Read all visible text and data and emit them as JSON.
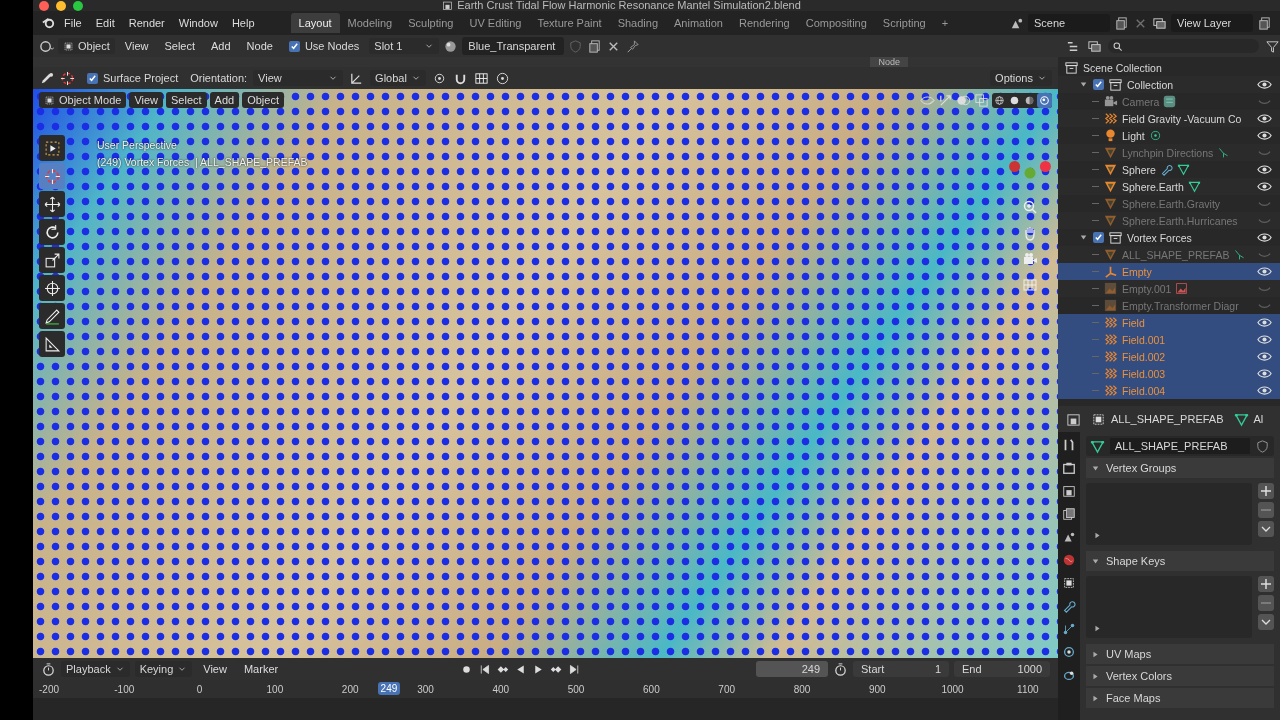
{
  "title_bar": {
    "title": "Earth Crust Tidal Flow Harmonic Resonance Mantel Simulation2.blend"
  },
  "menu_bar": {
    "menus": [
      "File",
      "Edit",
      "Render",
      "Window",
      "Help"
    ],
    "workspaces": [
      {
        "label": "Layout",
        "selected": true
      },
      {
        "label": "Modeling",
        "selected": false
      },
      {
        "label": "Sculpting",
        "selected": false
      },
      {
        "label": "UV Editing",
        "selected": false
      },
      {
        "label": "Texture Paint",
        "selected": false
      },
      {
        "label": "Shading",
        "selected": false
      },
      {
        "label": "Animation",
        "selected": false
      },
      {
        "label": "Rendering",
        "selected": false
      },
      {
        "label": "Compositing",
        "selected": false
      },
      {
        "label": "Scripting",
        "selected": false
      }
    ],
    "add_workspace": "+",
    "scene": "Scene",
    "view_layer": "View Layer"
  },
  "node_header": {
    "editor": "Object",
    "menus": [
      "View",
      "Select",
      "Add",
      "Node"
    ],
    "use_nodes": {
      "label": "Use Nodes",
      "checked": true
    },
    "slot": "Slot 1",
    "material": "Blue_Transparent"
  },
  "tool_settings": {
    "surface_project": {
      "label": "Surface Project",
      "checked": true
    },
    "orientation_label": "Orientation:",
    "orientation": "View",
    "transform": "Global",
    "options": "Options",
    "panel_tab": "Node"
  },
  "viewport": {
    "mode": "Object Mode",
    "menus": [
      "View",
      "Select",
      "Add",
      "Object"
    ],
    "perspective": "User Perspective",
    "info": "(249) Vortex Forces  | ALL_SHAPE_PREFAB",
    "tools": [
      {
        "kind": "select-box",
        "selected": false
      },
      {
        "kind": "cursor",
        "selected": true
      },
      {
        "kind": "move",
        "selected": false
      },
      {
        "kind": "rotate",
        "selected": false
      },
      {
        "kind": "scale",
        "selected": false
      },
      {
        "kind": "transform",
        "selected": false
      },
      {
        "kind": "annotate",
        "selected": false
      },
      {
        "kind": "measure",
        "selected": false
      }
    ],
    "shading": [
      {
        "kind": "wireframe",
        "selected": false
      },
      {
        "kind": "solid",
        "selected": false
      },
      {
        "kind": "material",
        "selected": false
      },
      {
        "kind": "rendered",
        "selected": true
      }
    ]
  },
  "outliner": {
    "root": "Scene Collection",
    "children": [
      {
        "name": "Collection",
        "kind": "collection",
        "checked": true,
        "expanded": true,
        "visible": true,
        "selected": false,
        "children": [
          {
            "name": "Camera",
            "kind": "camera",
            "visible": false,
            "selected": false,
            "extras": [
              {
                "kind": "camera-data"
              }
            ]
          },
          {
            "name": "Field Gravity -Vacuum Co",
            "kind": "field",
            "visible": true,
            "selected": false
          },
          {
            "name": "Light",
            "kind": "light",
            "visible": true,
            "selected": false,
            "extras": [
              {
                "kind": "light-data"
              }
            ]
          },
          {
            "name": "Lynchpin Directions",
            "kind": "mesh",
            "visible": false,
            "selected": false,
            "extras": [
              {
                "kind": "vertex-data"
              }
            ]
          },
          {
            "name": "Sphere",
            "kind": "mesh",
            "visible": true,
            "selected": false,
            "extras": [
              {
                "kind": "modifier"
              },
              {
                "kind": "mesh-data"
              }
            ]
          },
          {
            "name": "Sphere.Earth",
            "kind": "mesh",
            "visible": true,
            "selected": false,
            "extras": [
              {
                "kind": "mesh-data"
              }
            ]
          },
          {
            "name": "Sphere.Earth.Gravity",
            "kind": "mesh",
            "visible": false,
            "selected": false
          },
          {
            "name": "Sphere.Earth.Hurricanes",
            "kind": "mesh",
            "visible": false,
            "selected": false
          }
        ]
      },
      {
        "name": "Vortex Forces",
        "kind": "collection",
        "checked": true,
        "expanded": true,
        "visible": true,
        "selected": false,
        "children": [
          {
            "name": "ALL_SHAPE_PREFAB",
            "kind": "mesh",
            "visible": false,
            "selected": false,
            "extras": [
              {
                "kind": "vertex-data"
              }
            ]
          },
          {
            "name": "Empty",
            "kind": "empty",
            "visible": true,
            "selected": true
          },
          {
            "name": "Empty.001",
            "kind": "image",
            "visible": false,
            "selected": false,
            "extras": [
              {
                "kind": "image-data"
              }
            ]
          },
          {
            "name": "Empty.Transformer Diagr",
            "kind": "image",
            "visible": false,
            "selected": false
          },
          {
            "name": "Field",
            "kind": "field",
            "visible": true,
            "selected": true
          },
          {
            "name": "Field.001",
            "kind": "field",
            "visible": true,
            "selected": true
          },
          {
            "name": "Field.002",
            "kind": "field",
            "visible": true,
            "selected": true
          },
          {
            "name": "Field.003",
            "kind": "field",
            "visible": true,
            "selected": true
          },
          {
            "name": "Field.004",
            "kind": "field",
            "visible": true,
            "selected": true
          }
        ]
      }
    ]
  },
  "properties": {
    "object": "ALL_SHAPE_PREFAB",
    "data_tab": "Al",
    "mesh": "ALL_SHAPE_PREFAB",
    "tabs": [
      {
        "kind": "tool"
      },
      {
        "kind": "render"
      },
      {
        "kind": "output"
      },
      {
        "kind": "view-layer"
      },
      {
        "kind": "scene"
      },
      {
        "kind": "world"
      },
      {
        "kind": "object"
      },
      {
        "kind": "modifier"
      },
      {
        "kind": "particles"
      },
      {
        "kind": "physics"
      },
      {
        "kind": "constraint"
      }
    ],
    "panels": [
      {
        "title": "Vertex Groups",
        "expanded": true
      },
      {
        "title": "Shape Keys",
        "expanded": true
      },
      {
        "title": "UV Maps",
        "expanded": false
      },
      {
        "title": "Vertex Colors",
        "expanded": false
      },
      {
        "title": "Face Maps",
        "expanded": false
      }
    ]
  },
  "timeline": {
    "menus": [
      "Playback",
      "Keying",
      "View",
      "Marker"
    ],
    "current": "249",
    "playhead": "249",
    "start_label": "Start",
    "start": "1",
    "end_label": "End",
    "end": "1000",
    "ruler": [
      "-200",
      "-100",
      "0",
      "100",
      "200",
      "300",
      "400",
      "500",
      "600",
      "700",
      "800",
      "900",
      "1000",
      "1100"
    ]
  }
}
